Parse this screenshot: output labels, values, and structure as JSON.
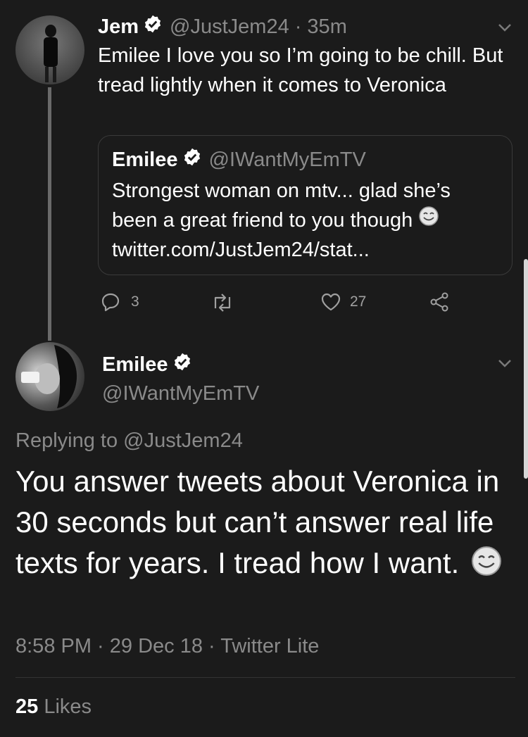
{
  "tweet1": {
    "name": "Jem",
    "handle": "@JustJem24",
    "time": "· 35m",
    "text": "Emilee I love you so I’m going to be chill. But tread lightly when it comes to Veronica",
    "quote": {
      "name": "Emilee",
      "handle": "@IWantMyEmTV",
      "text_line1": "Strongest woman on mtv... glad she’s",
      "text_line2": "been a great friend to you though",
      "text_line3": "twitter.com/JustJem24/stat..."
    },
    "actions": {
      "reply_count": "3",
      "retweet_count": "",
      "like_count": "27"
    }
  },
  "tweet2": {
    "name": "Emilee",
    "handle": "@IWantMyEmTV",
    "replying_to_prefix": "Replying to",
    "replying_to_handle": "@JustJem24",
    "text": "You answer tweets about Veronica in 30 seconds but can’t answer real life texts for years. I tread how I want.",
    "timestamp": "8:58 PM · 29 Dec 18 · Twitter Lite",
    "likes_count": "25",
    "likes_label": "Likes"
  },
  "icons": [
    "verified-icon",
    "chevron-down-icon",
    "reply-icon",
    "retweet-icon",
    "like-icon",
    "share-icon",
    "smiling-emoji-icon"
  ],
  "colors": {
    "background": "#1b1b1b",
    "muted_text": "#8a8a8a",
    "text": "#ffffff"
  }
}
